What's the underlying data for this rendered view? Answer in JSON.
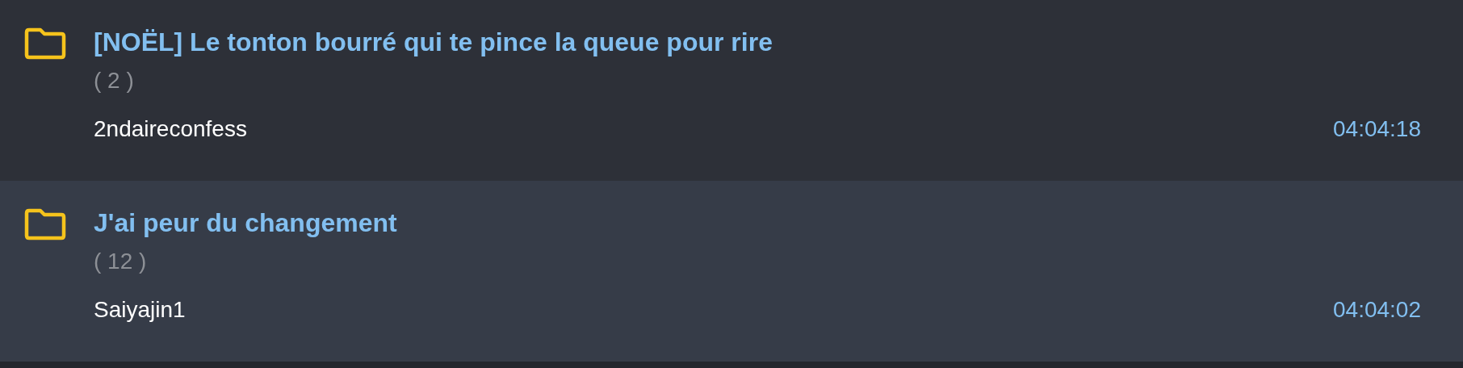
{
  "topics": [
    {
      "title": "[NOËL] Le tonton bourré qui te pince la queue pour rire",
      "count": "( 2 )",
      "author": "2ndaireconfess",
      "time": "04:04:18"
    },
    {
      "title": "J'ai peur du changement",
      "count": "( 12 )",
      "author": "Saiyajin1",
      "time": "04:04:02"
    }
  ]
}
